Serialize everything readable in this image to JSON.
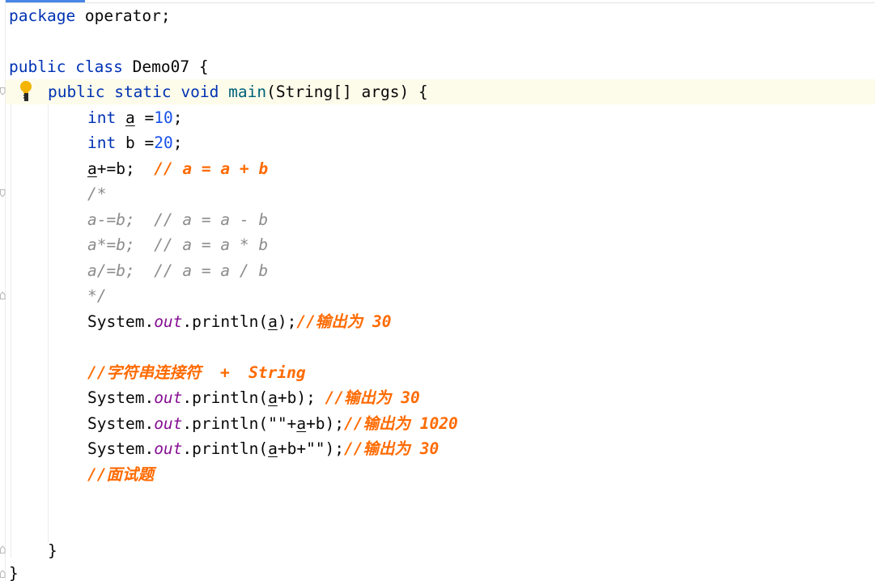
{
  "editor": {
    "colors": {
      "keyword": "#0033b3",
      "number": "#1750eb",
      "static_field": "#871094",
      "method_decl": "#00627a",
      "todo_comment": "#ff6a00",
      "block_comment": "#8c8c8c",
      "current_line_bg": "#fdfbea"
    },
    "icons": {
      "intention": "lightbulb-icon",
      "fold": "fold-marker-icon"
    },
    "code": {
      "l1": {
        "kw": "package",
        "rest": " operator;"
      },
      "l3": {
        "kw1": "public",
        "kw2": "class",
        "rest": " Demo07 {"
      },
      "l4": {
        "kw1": "public",
        "kw2": "static",
        "kw3": "void",
        "fn": "main",
        "rest": "(String[] args) {"
      },
      "l5": {
        "kw": "int",
        "var": "a",
        "op": " =",
        "num": "10",
        "end": ";"
      },
      "l6": {
        "kw": "int",
        "rest": " b =",
        "num": "20",
        "end": ";"
      },
      "l7": {
        "var": "a",
        "rest": "+=b;  ",
        "comment": "// a = a + b"
      },
      "l8": {
        "text": "/*"
      },
      "l9": {
        "text": "a-=b;  // a = a - b"
      },
      "l10": {
        "text": "a*=b;  // a = a * b"
      },
      "l11": {
        "text": "a/=b;  // a = a / b"
      },
      "l12": {
        "text": "*/"
      },
      "l13": {
        "obj": "System.",
        "field": "out",
        "call": ".println(",
        "var": "a",
        "end": ");",
        "comment": "//输出为 30"
      },
      "l15": {
        "comment": "//字符串连接符  +  String"
      },
      "l16": {
        "obj": "System.",
        "field": "out",
        "call": ".println(",
        "var": "a",
        "mid": "+b); ",
        "comment": "//输出为 30"
      },
      "l17": {
        "obj": "System.",
        "field": "out",
        "call": ".println(\"\"+",
        "var": "a",
        "mid": "+b);",
        "comment": "//输出为 1020"
      },
      "l18": {
        "obj": "System.",
        "field": "out",
        "call": ".println(",
        "var": "a",
        "mid": "+b+\"\");",
        "comment": "//输出为 30"
      },
      "l19": {
        "comment": "//面试题"
      },
      "l22": {
        "text": "}"
      },
      "l23": {
        "text": "}"
      }
    }
  }
}
